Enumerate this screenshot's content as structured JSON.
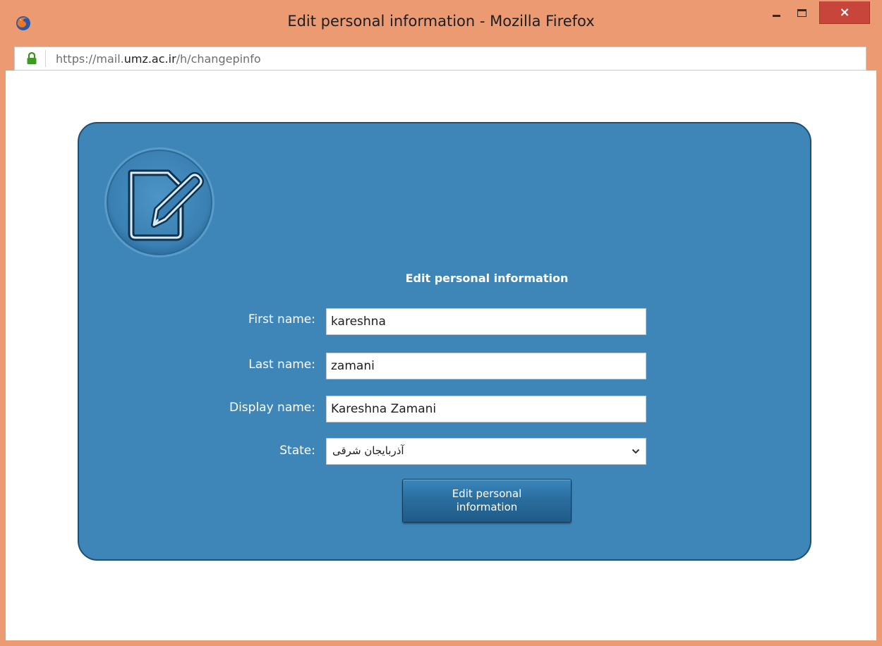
{
  "window": {
    "title": "Edit personal information - Mozilla Firefox",
    "close_label": "×"
  },
  "urlbar": {
    "url_prefix": "https://mail.",
    "url_host": "umz.ac.ir",
    "url_path": "/h/changepinfo"
  },
  "form": {
    "title": "Edit personal information",
    "fields": {
      "first_name": {
        "label": "First name:",
        "value": "kareshna"
      },
      "last_name": {
        "label": "Last name:",
        "value": "zamani"
      },
      "display_name": {
        "label": "Display name:",
        "value": "Kareshna Zamani"
      },
      "state": {
        "label": "State:",
        "selected": "آذربایجان شرقی"
      }
    },
    "submit_label": "Edit personal information"
  },
  "colors": {
    "frame": "#EC9A72",
    "panel": "#3E86B8",
    "panel_border": "#1F4F72",
    "close_button": "#C7453A"
  },
  "icons": {
    "app": "firefox-icon",
    "lock": "lock-icon",
    "emblem": "edit-document-icon",
    "dropdown": "chevron-down-icon"
  }
}
